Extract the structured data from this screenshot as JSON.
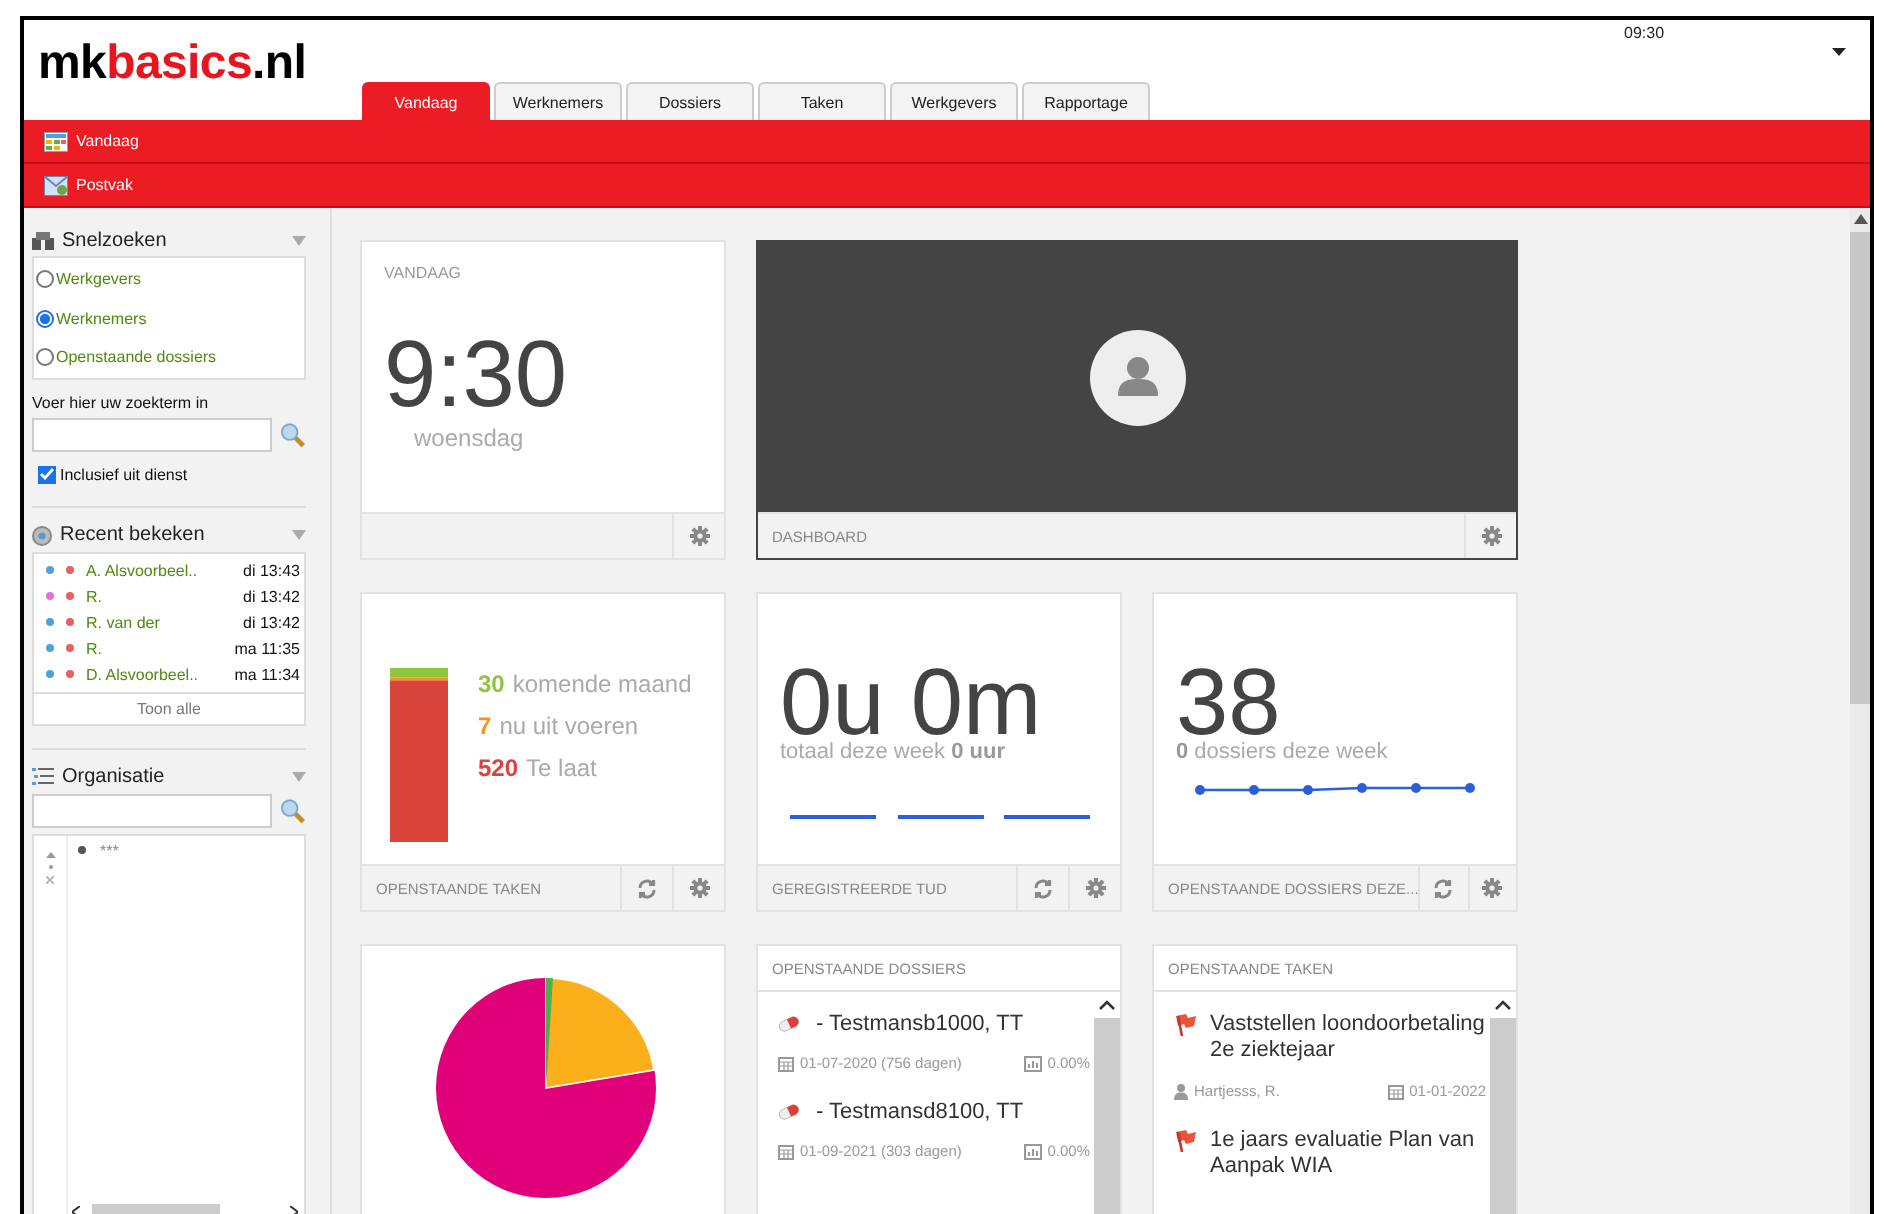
{
  "header": {
    "logo": [
      {
        "text": "mk",
        "accent": false
      },
      {
        "text": "basics",
        "accent": true
      },
      {
        "text": ".nl",
        "accent": false
      }
    ],
    "time": "09:30"
  },
  "tabs": [
    {
      "label": "Vandaag",
      "selected": true
    },
    {
      "label": "Werknemers",
      "selected": false
    },
    {
      "label": "Dossiers",
      "selected": false
    },
    {
      "label": "Taken",
      "selected": false
    },
    {
      "label": "Werkgevers",
      "selected": false
    },
    {
      "label": "Rapportage",
      "selected": false
    }
  ],
  "menu": [
    {
      "label": "Vandaag",
      "kind": "calendar"
    },
    {
      "label": "Postvak",
      "kind": "mail"
    }
  ],
  "sidebar": {
    "quick_search": {
      "title": "Snelzoeken",
      "options": [
        {
          "label": "Werkgevers",
          "selected": false
        },
        {
          "label": "Werknemers",
          "selected": true
        },
        {
          "label": "Openstaande dossiers",
          "selected": false
        }
      ],
      "search_label": "Voer hier uw zoekterm in",
      "checkbox": {
        "label": "Inclusief uit dienst",
        "checked": true
      }
    },
    "recent": {
      "title": "Recent bekeken",
      "items": [
        {
          "name": "A. Alsvoorbeel..",
          "time": "di 13:43",
          "color": "#4aa3df"
        },
        {
          "name": "R.",
          "time": "di 13:42",
          "color": "#e86be0"
        },
        {
          "name": "R. van der",
          "time": "di 13:42",
          "color": "#4aa3df"
        },
        {
          "name": "R.",
          "time": "ma 11:35",
          "color": "#4aa3df"
        },
        {
          "name": "D. Alsvoorbeel..",
          "time": "ma 11:34",
          "color": "#4aa3df"
        }
      ],
      "show_all": "Toon alle"
    },
    "organisation": {
      "title": "Organisatie",
      "tree": [
        {
          "label": "***"
        }
      ]
    }
  },
  "cards": {
    "today": {
      "title": "VANDAAG",
      "time": "9:30",
      "day": "woensdag"
    },
    "dashboard": {
      "footer": "DASHBOARD"
    },
    "tasks": {
      "footer": "OPENSTAANDE TAKEN",
      "stats": [
        {
          "count": "30",
          "label": "komende maand",
          "color": "#8dc63f"
        },
        {
          "count": "7",
          "label": "nu uit voeren",
          "color": "#f7941d"
        },
        {
          "count": "520",
          "label": "Te laat",
          "color": "#d9453d"
        }
      ]
    },
    "hours": {
      "value": "0u 0m",
      "caption": "totaal deze week **0 uur**",
      "footer": "GEREGISTREERDE TUD"
    },
    "files_week": {
      "value": "38",
      "caption": "**0** dossiers deze week",
      "footer": "OPENSTAANDE DOSSIERS DEZE..."
    },
    "open_files": {
      "title": "OPENSTAANDE DOSSIERS",
      "items": [
        {
          "name": "- Testmansb1000, TT",
          "date": "01-07-2020 (756 dagen)",
          "percent": "0.00%"
        },
        {
          "name": "- Testmansd8100, TT",
          "date": "01-09-2021 (303 dagen)",
          "percent": "0.00%"
        }
      ]
    },
    "open_tasks": {
      "title": "OPENSTAANDE TAKEN",
      "items": [
        {
          "title": "Vaststellen loondoorbetaling 2e ziektejaar",
          "person": "Hartjesss, R.",
          "date": "01-01-2022"
        },
        {
          "title": "1e jaars evaluatie Plan van Aanpak WIA"
        }
      ]
    }
  }
}
